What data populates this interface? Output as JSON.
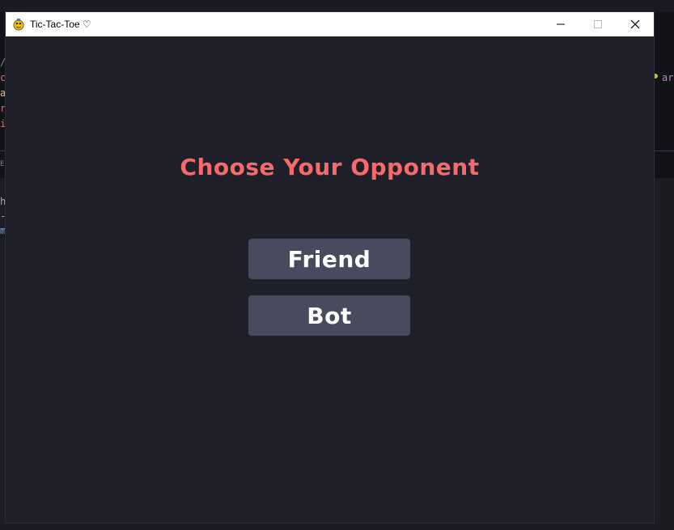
{
  "window": {
    "title": "Tic-Tac-Toe ♡",
    "controls": {
      "minimize": "minimize",
      "maximize": "maximize",
      "close": "close"
    }
  },
  "main": {
    "heading": "Choose Your Opponent",
    "options": [
      {
        "label": "Friend"
      },
      {
        "label": "Bot"
      }
    ]
  },
  "background": {
    "right_fragment": "ar",
    "left_fragments": [
      "/",
      "c",
      "a",
      "r",
      "i",
      "EB",
      "h",
      "-",
      "m"
    ]
  },
  "colors": {
    "heading": "#f76a6a",
    "button": "#484a5e",
    "background": "#1e1f29"
  }
}
